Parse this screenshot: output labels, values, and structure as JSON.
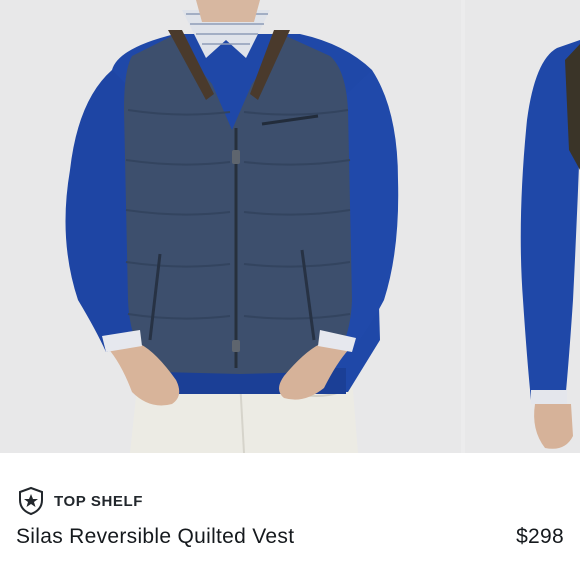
{
  "gallery": {
    "images": [
      {
        "name": "vest-front-photo"
      },
      {
        "name": "vest-side-photo"
      }
    ]
  },
  "product": {
    "brand": "TOP SHELF",
    "brand_icon": "shield-logo-icon",
    "title": "Silas Reversible Quilted Vest",
    "price": "$298"
  },
  "colors": {
    "vest": "#3d4f6d",
    "sweater": "#1f48a8",
    "pants": "#ecebe4",
    "background": "#e8e8e9"
  }
}
